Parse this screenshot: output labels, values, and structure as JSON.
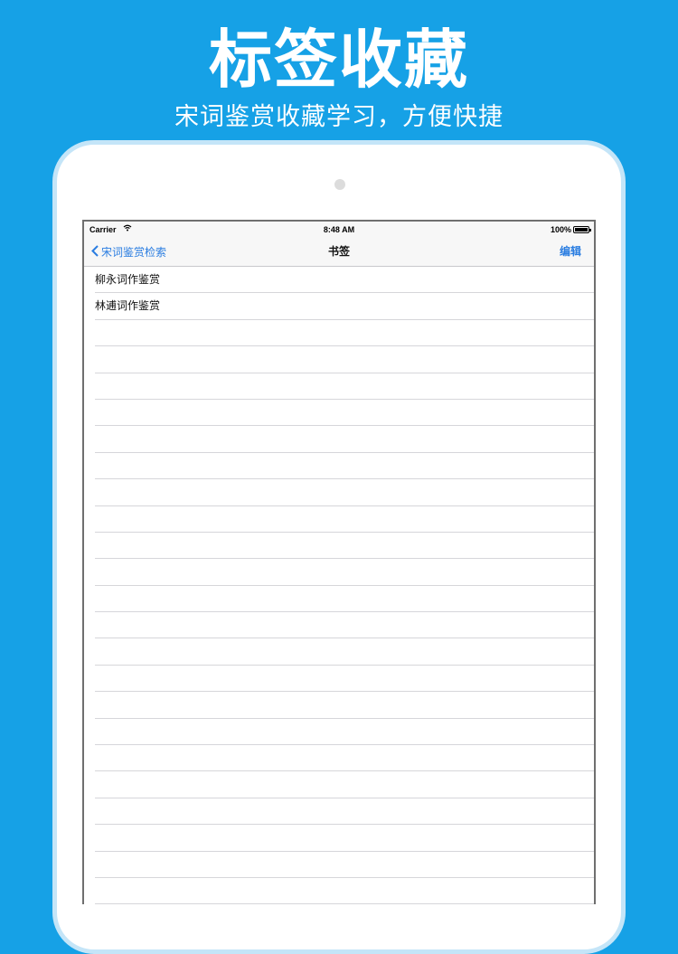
{
  "promo": {
    "headline": "标签收藏",
    "subline": "宋词鉴赏收藏学习，方便快捷"
  },
  "status_bar": {
    "carrier": "Carrier",
    "time": "8:48 AM",
    "battery": "100%"
  },
  "nav": {
    "back_label": "宋词鉴赏检索",
    "title": "书签",
    "edit_label": "编辑"
  },
  "bookmarks": [
    {
      "title": "柳永词作鉴赏"
    },
    {
      "title": "林逋词作鉴赏"
    }
  ],
  "colors": {
    "background": "#16a1e6",
    "tint": "#2a7de1"
  }
}
